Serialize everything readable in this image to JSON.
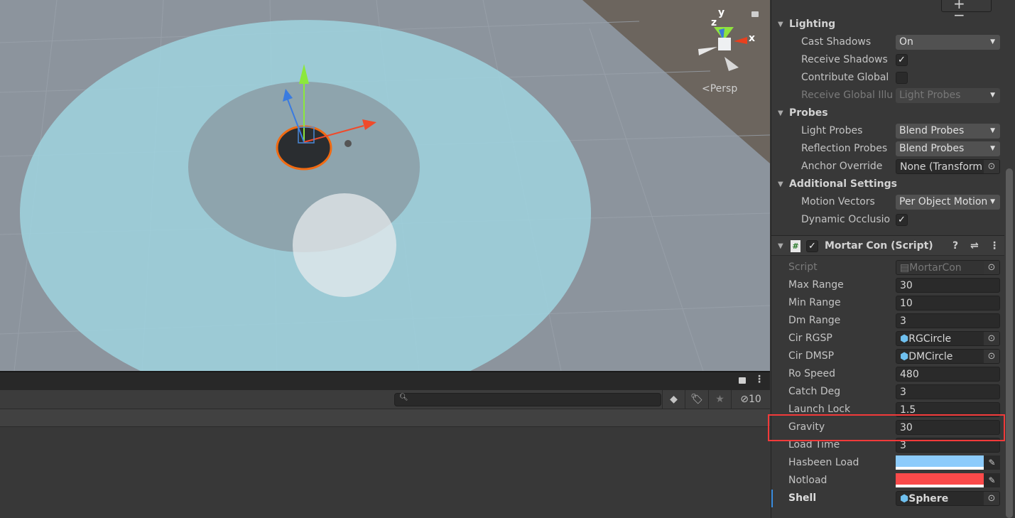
{
  "scene": {
    "persp_label": "Persp",
    "axis_x": "x",
    "axis_y": "y",
    "axis_z": "z"
  },
  "bottom_panel": {
    "search_placeholder": "",
    "hidden_count": "10"
  },
  "inspector": {
    "add_remove": "+−",
    "lighting": {
      "title": "Lighting",
      "rows": [
        {
          "label": "Cast Shadows",
          "type": "dropdown",
          "value": "On"
        },
        {
          "label": "Receive Shadows",
          "type": "checkbox",
          "checked": true
        },
        {
          "label": "Contribute Global",
          "type": "checkbox",
          "checked": false
        },
        {
          "label": "Receive Global Illu",
          "type": "dropdown",
          "value": "Light Probes",
          "disabled": true
        }
      ]
    },
    "probes": {
      "title": "Probes",
      "rows": [
        {
          "label": "Light Probes",
          "type": "dropdown",
          "value": "Blend Probes"
        },
        {
          "label": "Reflection Probes",
          "type": "dropdown",
          "value": "Blend Probes"
        },
        {
          "label": "Anchor Override",
          "type": "object",
          "value": "None (Transform"
        }
      ]
    },
    "additional": {
      "title": "Additional Settings",
      "rows": [
        {
          "label": "Motion Vectors",
          "type": "dropdown",
          "value": "Per Object Motion"
        },
        {
          "label": "Dynamic Occlusio",
          "type": "checkbox",
          "checked": true
        }
      ]
    },
    "component": {
      "title": "Mortar Con (Script)",
      "enabled": true,
      "rows": [
        {
          "label": "Script",
          "type": "object",
          "value": "MortarCon",
          "disabled": true,
          "icon": "script"
        },
        {
          "label": "Max Range",
          "type": "text",
          "value": "30"
        },
        {
          "label": "Min Range",
          "type": "text",
          "value": "10"
        },
        {
          "label": "Dm Range",
          "type": "text",
          "value": "3"
        },
        {
          "label": "Cir RGSP",
          "type": "object",
          "value": "RGCircle",
          "icon": "prefab"
        },
        {
          "label": "Cir DMSP",
          "type": "object",
          "value": "DMCircle",
          "icon": "prefab"
        },
        {
          "label": "Ro Speed",
          "type": "text",
          "value": "480"
        },
        {
          "label": "Catch Deg",
          "type": "text",
          "value": "3"
        },
        {
          "label": "Launch Lock",
          "type": "text",
          "value": "1.5"
        },
        {
          "label": "Gravity",
          "type": "text",
          "value": "30"
        },
        {
          "label": "Load Time",
          "type": "text",
          "value": "3"
        },
        {
          "label": "Hasbeen Load",
          "type": "color",
          "value": "#8ccbfb"
        },
        {
          "label": "Notload",
          "type": "color",
          "value": "#fb4a4a"
        },
        {
          "label": "Shell",
          "type": "object",
          "value": "Sphere",
          "icon": "prefab",
          "bold": true
        }
      ]
    }
  },
  "colors": {
    "highlight": "#f23a3a"
  }
}
